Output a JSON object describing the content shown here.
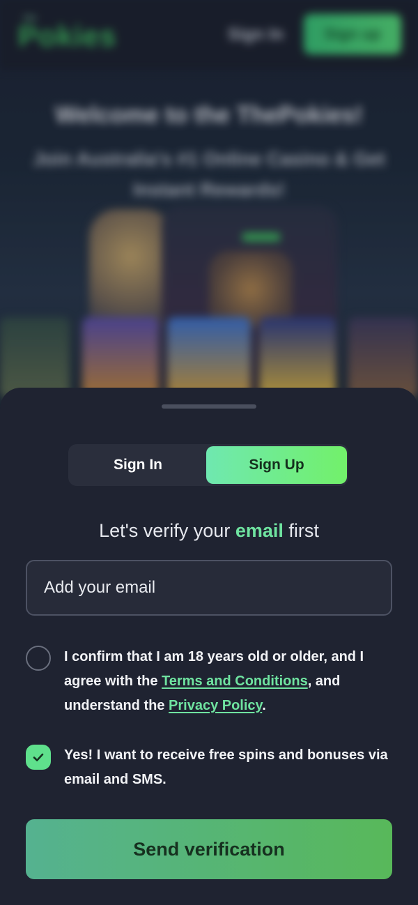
{
  "header": {
    "logo_small": "the",
    "logo": "Pokies",
    "signin_label": "Sign In",
    "signup_label": "Sign up"
  },
  "hero": {
    "title": "Welcome to the ThePokies!",
    "subtitle": "Join Australia's #1 Online Casino & Get Instant Rewards!"
  },
  "sheet": {
    "tabs": [
      {
        "label": "Sign In",
        "active": false
      },
      {
        "label": "Sign Up",
        "active": true
      }
    ],
    "verify_prefix": "Let's verify your",
    "verify_emphasis": "email",
    "verify_suffix": "first",
    "email": {
      "value": "",
      "placeholder": "Add your email"
    },
    "age_consent": {
      "checked": false,
      "text_1": "I confirm that I am 18 years old or older, and I agree with the",
      "terms_link": "Terms and Conditions",
      "text_2": ", and understand the",
      "privacy_link": "Privacy Policy",
      "text_3": "."
    },
    "promo_consent": {
      "checked": true,
      "text": "Yes! I want to receive free spins and bonuses via email and SMS."
    },
    "submit_label": "Send verification"
  },
  "colors": {
    "accent": "#6fe3a0",
    "accent_green": "#72f06a",
    "sheet_bg": "#1f2331",
    "button_gradient_start": "#55b290",
    "button_gradient_end": "#58b85a"
  },
  "icons": {
    "promo_check": "checkmark-icon"
  }
}
